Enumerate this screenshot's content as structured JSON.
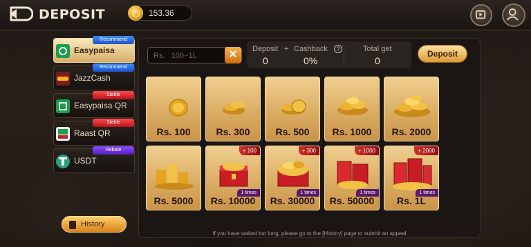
{
  "header": {
    "title": "DEPOSIT",
    "balance": "153.36",
    "back_icon": "back-arrow-icon",
    "video_icon": "video-icon",
    "profile_icon": "profile-icon"
  },
  "sidebar": {
    "items": [
      {
        "label": "Easypaisa",
        "tag": "Recommend",
        "tag_color": "#2a6cf0",
        "active": true
      },
      {
        "label": "JazzCash",
        "tag": "Recommend",
        "tag_color": "#2a6cf0",
        "active": false
      },
      {
        "label": "Easypaisa QR",
        "tag": "Stable",
        "tag_color": "#d81f26",
        "active": false
      },
      {
        "label": "Raast QR",
        "tag": "Stable",
        "tag_color": "#d81f26",
        "active": false
      },
      {
        "label": "USDT",
        "tag": "Rebate",
        "tag_color": "#6a30e0",
        "active": false
      }
    ],
    "history_label": "History"
  },
  "form": {
    "amount_placeholder": "Rs.   100~1L",
    "clear_icon": "close-icon",
    "deposit_label": "Deposit",
    "plus": "+",
    "cashback_label": "Cashback",
    "help_icon": "help-icon",
    "total_label": "Total get",
    "deposit_value": "0",
    "cashback_value": "0%",
    "total_value": "0",
    "deposit_button": "Deposit"
  },
  "amounts": [
    {
      "label": "Rs. 100",
      "bonus": "",
      "times": ""
    },
    {
      "label": "Rs. 300",
      "bonus": "",
      "times": ""
    },
    {
      "label": "Rs. 500",
      "bonus": "",
      "times": ""
    },
    {
      "label": "Rs. 1000",
      "bonus": "",
      "times": ""
    },
    {
      "label": "Rs. 2000",
      "bonus": "",
      "times": ""
    },
    {
      "label": "Rs. 5000",
      "bonus": "",
      "times": ""
    },
    {
      "label": "Rs. 10000",
      "bonus": "+ 100",
      "times": "1 times"
    },
    {
      "label": "Rs. 30000",
      "bonus": "+ 300",
      "times": "1 times"
    },
    {
      "label": "Rs. 50000",
      "bonus": "+ 1000",
      "times": "1 times"
    },
    {
      "label": "Rs. 1L",
      "bonus": "+ 2000",
      "times": "1 times"
    }
  ],
  "footer": {
    "note": "If you have waited too long, please go to the [History] page to submit an appeal"
  },
  "colors": {
    "accent_gold": "#e0a443",
    "background": "#1f1915"
  }
}
